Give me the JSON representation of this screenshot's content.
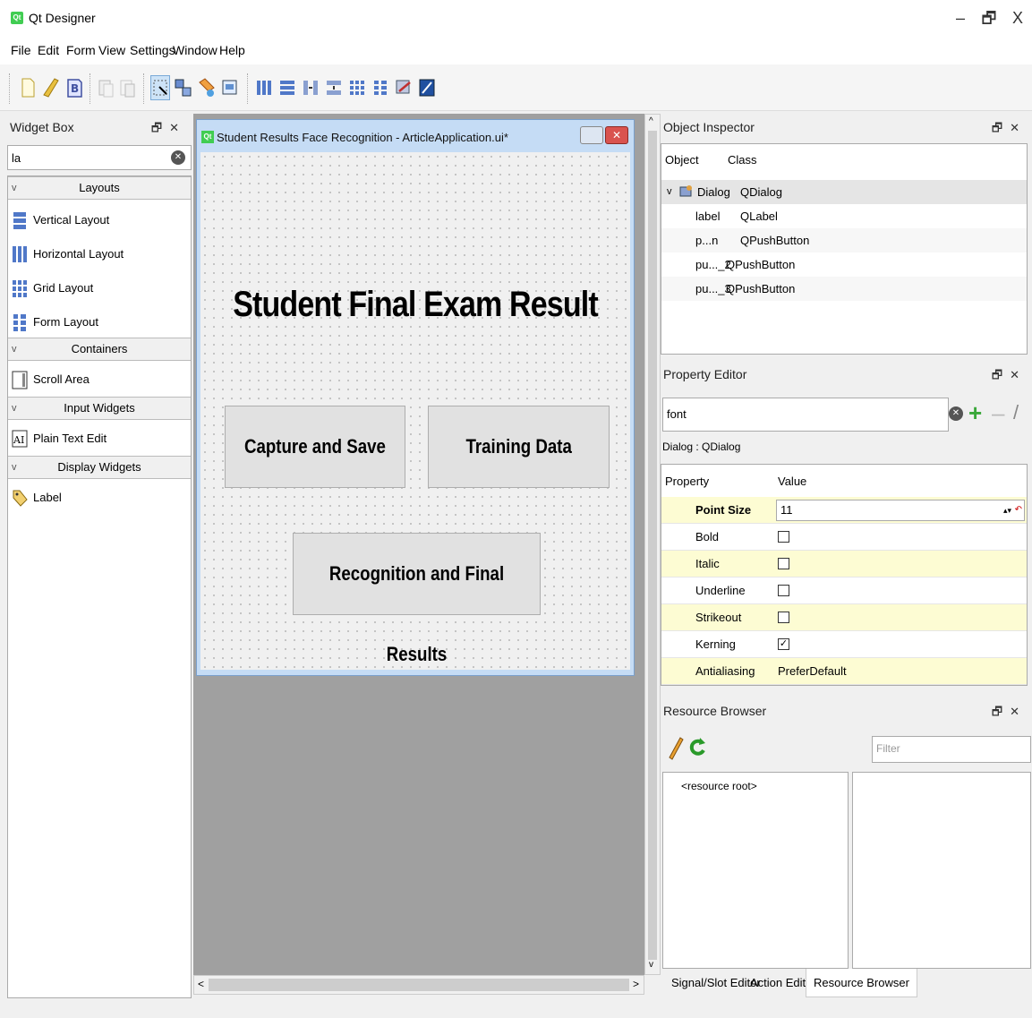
{
  "app": {
    "title": "Qt Designer",
    "icon_text": "Qt"
  },
  "window_controls": {
    "minimize": "–",
    "maximize": "🗗",
    "close": "X"
  },
  "menu": [
    "File",
    "Edit",
    "Form",
    "View",
    "Settings",
    "Window",
    "Help"
  ],
  "widget_box": {
    "title": "Widget Box",
    "search_value": "la",
    "categories": [
      {
        "name": "Layouts",
        "items": [
          "Vertical Layout",
          "Horizontal Layout",
          "Grid Layout",
          "Form Layout"
        ]
      },
      {
        "name": "Containers",
        "items": [
          "Scroll Area"
        ]
      },
      {
        "name": "Input Widgets",
        "items": [
          "Plain Text Edit"
        ]
      },
      {
        "name": "Display Widgets",
        "items": [
          "Label"
        ]
      }
    ]
  },
  "form": {
    "window_title": "Student Results Face Recognition - ArticleApplication.ui*",
    "heading": "Student Final Exam Result",
    "buttons": {
      "capture": "Capture and Save",
      "training": "Training Data",
      "recognition": "Recognition and Final Results"
    }
  },
  "object_inspector": {
    "title": "Object Inspector",
    "col_object": "Object",
    "col_class": "Class",
    "rows": [
      {
        "object": "Dialog",
        "class": "QDialog"
      },
      {
        "object": "label",
        "class": "QLabel"
      },
      {
        "object": "p...n",
        "class": "QPushButton"
      },
      {
        "object": "pu..._2",
        "class": "QPushButton"
      },
      {
        "object": "pu..._3",
        "class": "QPushButton"
      }
    ]
  },
  "property_editor": {
    "title": "Property Editor",
    "filter_value": "font",
    "context": "Dialog : QDialog",
    "col_property": "Property",
    "col_value": "Value",
    "rows": [
      {
        "name": "Point Size",
        "value": "11"
      },
      {
        "name": "Bold",
        "checked": false
      },
      {
        "name": "Italic",
        "checked": false
      },
      {
        "name": "Underline",
        "checked": false
      },
      {
        "name": "Strikeout",
        "checked": false
      },
      {
        "name": "Kerning",
        "checked": true
      },
      {
        "name": "Antialiasing",
        "value": "PreferDefault"
      }
    ]
  },
  "resource_browser": {
    "title": "Resource Browser",
    "filter_placeholder": "Filter",
    "root": "<resource root>"
  },
  "bottom_tabs": [
    "Signal/Slot Editor",
    "Action Editor",
    "Resource Browser"
  ],
  "colors": {
    "highlight_row": "#fdfcd3",
    "qt_green": "#41cd52",
    "mdi_bg": "#a0a0a0"
  }
}
